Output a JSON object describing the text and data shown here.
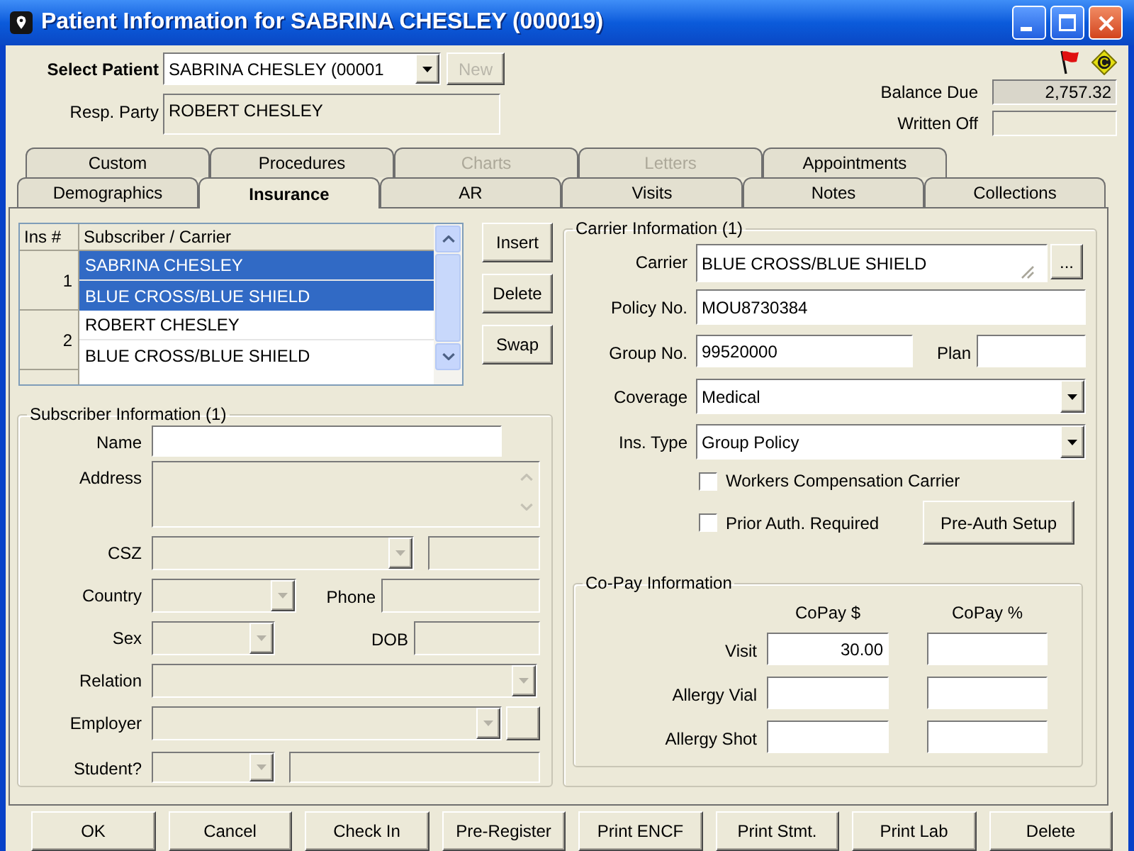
{
  "window": {
    "title": "Patient Information for SABRINA CHESLEY (000019)"
  },
  "patient_header": {
    "select_label": "Select Patient",
    "patient": "SABRINA CHESLEY (00001",
    "new_button": {
      "label": "New",
      "disabled": true
    },
    "resp_party_label": "Resp. Party",
    "resp_party": "ROBERT CHESLEY",
    "status_sign": "C",
    "balance_due_label": "Balance Due",
    "balance_due": "2,757.32",
    "written_off_label": "Written Off"
  },
  "tabs": {
    "back_row": [
      {
        "label": "Custom",
        "selected": false,
        "disabled": false
      },
      {
        "label": "Procedures",
        "selected": false,
        "disabled": false
      },
      {
        "label": "Charts",
        "selected": false,
        "disabled": true
      },
      {
        "label": "Letters",
        "selected": false,
        "disabled": true
      },
      {
        "label": "Appointments",
        "selected": false,
        "disabled": false
      }
    ],
    "front_row": [
      {
        "label": "Demographics",
        "selected": false,
        "disabled": false
      },
      {
        "label": "Insurance",
        "selected": true,
        "disabled": false
      },
      {
        "label": "AR",
        "selected": false,
        "disabled": false
      },
      {
        "label": "Visits",
        "selected": false,
        "disabled": false
      },
      {
        "label": "Notes",
        "selected": false,
        "disabled": false
      },
      {
        "label": "Collections",
        "selected": false,
        "disabled": false
      }
    ]
  },
  "insurance_list": {
    "columns": [
      "Ins #",
      "Subscriber / Carrier"
    ],
    "rows": [
      {
        "number": "1",
        "subscriber": "SABRINA CHESLEY",
        "carrier": "BLUE CROSS/BLUE SHIELD",
        "selected": true
      },
      {
        "number": "2",
        "subscriber": "ROBERT CHESLEY",
        "carrier": "BLUE CROSS/BLUE SHIELD",
        "selected": false
      }
    ]
  },
  "list_buttons": [
    "Insert",
    "Delete",
    "Swap"
  ],
  "subscriber_info": {
    "title": "Subscriber Information (1)",
    "rows": [
      {
        "label": "Name",
        "controls": [
          {
            "kind": "text",
            "disabled": false
          }
        ]
      },
      {
        "label": "Address",
        "controls": [
          {
            "kind": "memo",
            "disabled": true
          }
        ]
      },
      {
        "label": "CSZ",
        "controls": [
          {
            "kind": "combo",
            "disabled": true
          },
          {
            "kind": "text",
            "disabled": true
          }
        ]
      },
      {
        "label": "Country",
        "controls": [
          {
            "kind": "combo",
            "disabled": true
          },
          {
            "kind": "label",
            "text": "Phone"
          },
          {
            "kind": "text",
            "disabled": true
          }
        ]
      },
      {
        "label": "Sex",
        "controls": [
          {
            "kind": "combo",
            "disabled": true
          },
          {
            "kind": "label",
            "text": "DOB"
          },
          {
            "kind": "text",
            "disabled": true
          }
        ]
      },
      {
        "label": "Relation",
        "controls": [
          {
            "kind": "combo",
            "disabled": true
          }
        ]
      },
      {
        "label": "Employer",
        "controls": [
          {
            "kind": "combo",
            "disabled": true
          },
          {
            "kind": "button"
          }
        ]
      },
      {
        "label": "Student?",
        "controls": [
          {
            "kind": "combo",
            "disabled": true
          },
          {
            "kind": "text",
            "disabled": true
          }
        ]
      }
    ]
  },
  "carrier_info": {
    "title": "Carrier Information (1)",
    "carrier": {
      "label": "Carrier",
      "value": "BLUE CROSS/BLUE SHIELD",
      "button": "..."
    },
    "policy_no": {
      "label": "Policy No.",
      "value": "MOU8730384"
    },
    "group_no": {
      "label": "Group No.",
      "value": "99520000"
    },
    "plan": {
      "label": "Plan"
    },
    "coverage": {
      "label": "Coverage",
      "value": "Medical"
    },
    "ins_type": {
      "label": "Ins. Type",
      "value": "Group Policy"
    },
    "options": [
      {
        "label": "Workers Compensation Carrier",
        "checked": false
      },
      {
        "label": "Prior Auth. Required",
        "checked": false
      }
    ],
    "pre_auth_button": "Pre-Auth Setup",
    "copay": {
      "title": "Co-Pay Information",
      "columns": [
        "CoPay $",
        "CoPay %"
      ],
      "rows": [
        {
          "label": "Visit",
          "amount": "30.00"
        },
        {
          "label": "Allergy Vial"
        },
        {
          "label": "Allergy Shot"
        }
      ]
    }
  },
  "footer_buttons": [
    "OK",
    "Cancel",
    "Check In",
    "Pre-Register",
    "Print ENCF",
    "Print Stmt.",
    "Print Lab",
    "Delete"
  ]
}
